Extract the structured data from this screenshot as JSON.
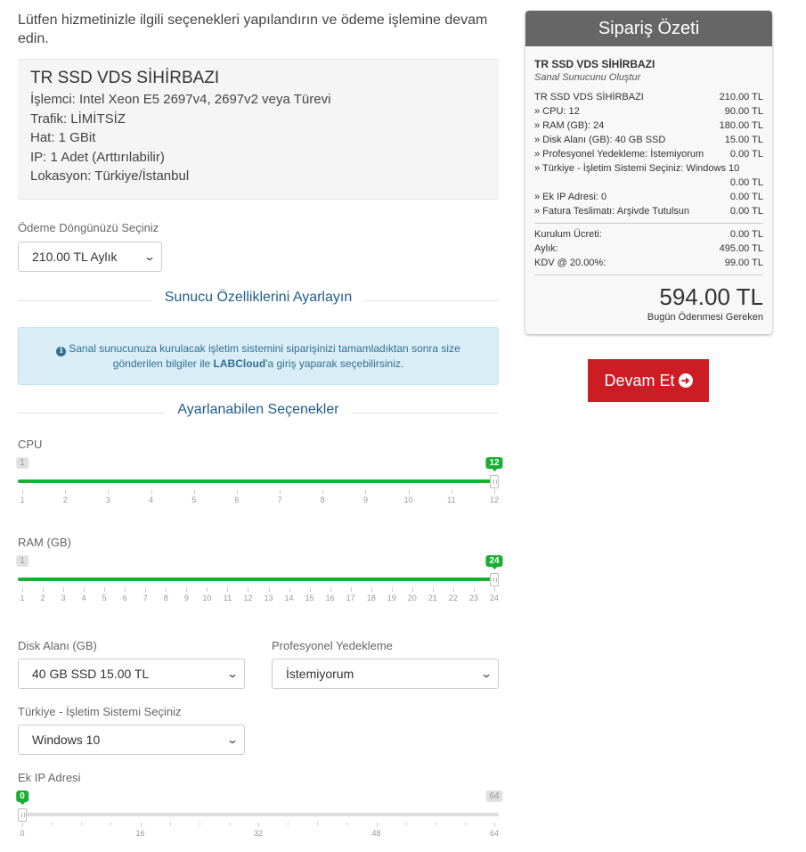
{
  "intro": "Lütfen hizmetinizle ilgili seçenekleri yapılandırın ve ödeme işlemine devam edin.",
  "product": {
    "name": "TR SSD VDS SİHİRBAZI",
    "lines": [
      "İşlemci: Intel Xeon E5 2697v4, 2697v2 veya Türevi",
      "Trafik: LİMİTSİZ",
      "Hat: 1 GBit",
      "IP: 1 Adet (Arttırılabilir)",
      "Lokasyon: Türkiye/İstanbul"
    ]
  },
  "billing": {
    "label": "Ödeme Döngünüzü Seçiniz",
    "value": "210.00 TL Aylık"
  },
  "section1": "Sunucu Özelliklerini Ayarlayın",
  "alert": {
    "text_before": "Sanal sunucunuza kurulacak işletim sistemini siparişinizi tamamladıktan sonra size gönderilen bilgiler ile ",
    "brand": "LABCloud",
    "text_after": "'a giriş yaparak seçebilirsiniz."
  },
  "section2": "Ayarlanabilen Seçenekler",
  "sliders": {
    "cpu": {
      "label": "CPU",
      "min": 1,
      "max": 12,
      "value": 12,
      "min_label": "1",
      "value_label": "12",
      "ticks": [
        "1",
        "2",
        "3",
        "4",
        "5",
        "6",
        "7",
        "8",
        "9",
        "10",
        "11",
        "12"
      ]
    },
    "ram": {
      "label": "RAM (GB)",
      "min": 1,
      "max": 24,
      "value": 24,
      "min_label": "1",
      "value_label": "24",
      "ticks": [
        "1",
        "2",
        "3",
        "4",
        "5",
        "6",
        "7",
        "8",
        "9",
        "10",
        "11",
        "12",
        "13",
        "14",
        "15",
        "16",
        "17",
        "18",
        "19",
        "20",
        "21",
        "22",
        "23",
        "24"
      ]
    },
    "ip": {
      "label": "Ek IP Adresi",
      "min": 0,
      "max": 64,
      "value": 0,
      "value_label": "0",
      "max_label": "64",
      "ticks": [
        "0",
        "16",
        "32",
        "48",
        "64"
      ]
    }
  },
  "disk": {
    "label": "Disk Alanı (GB)",
    "value": "40 GB SSD 15.00 TL"
  },
  "backup": {
    "label": "Profesyonel Yedekleme",
    "value": "İstemiyorum"
  },
  "os": {
    "label": "Türkiye - İşletim Sistemi Seçiniz",
    "value": "Windows 10"
  },
  "summary": {
    "title": "Sipariş Özeti",
    "product": "TR SSD VDS SİHİRBAZI",
    "group": "Sanal Sunucunu Oluştur",
    "base": {
      "label": "TR SSD VDS SİHİRBAZI",
      "price": "210.00 TL"
    },
    "items": [
      {
        "label": "» CPU: 12",
        "price": "90.00 TL"
      },
      {
        "label": "» RAM (GB): 24",
        "price": "180.00 TL"
      },
      {
        "label": "» Disk Alanı (GB): 40 GB SSD",
        "price": "15.00 TL"
      },
      {
        "label": "» Profesyonel Yedekleme: İstemiyorum",
        "price": "0.00 TL"
      },
      {
        "label": "» Türkiye - İşletim Sistemi Seçiniz: Windows 10",
        "price": "0.00 TL"
      },
      {
        "label": "» Ek IP Adresi: 0",
        "price": "0.00 TL"
      },
      {
        "label": "» Fatura Teslimatı: Arşivde Tutulsun",
        "price": "0.00 TL"
      }
    ],
    "setup": {
      "label": "Kurulum Ücreti:",
      "price": "0.00 TL"
    },
    "monthly": {
      "label": "Aylık:",
      "price": "495.00 TL"
    },
    "tax": {
      "label": "KDV @ 20.00%:",
      "price": "99.00 TL"
    },
    "total": "594.00 TL",
    "due": "Bugün Ödenmesi Gereken"
  },
  "checkout": {
    "label": "Devam Et"
  },
  "colors": {
    "accent": "#1aaf33",
    "danger": "#cc1d24",
    "title_blue": "#1f5e8a"
  }
}
